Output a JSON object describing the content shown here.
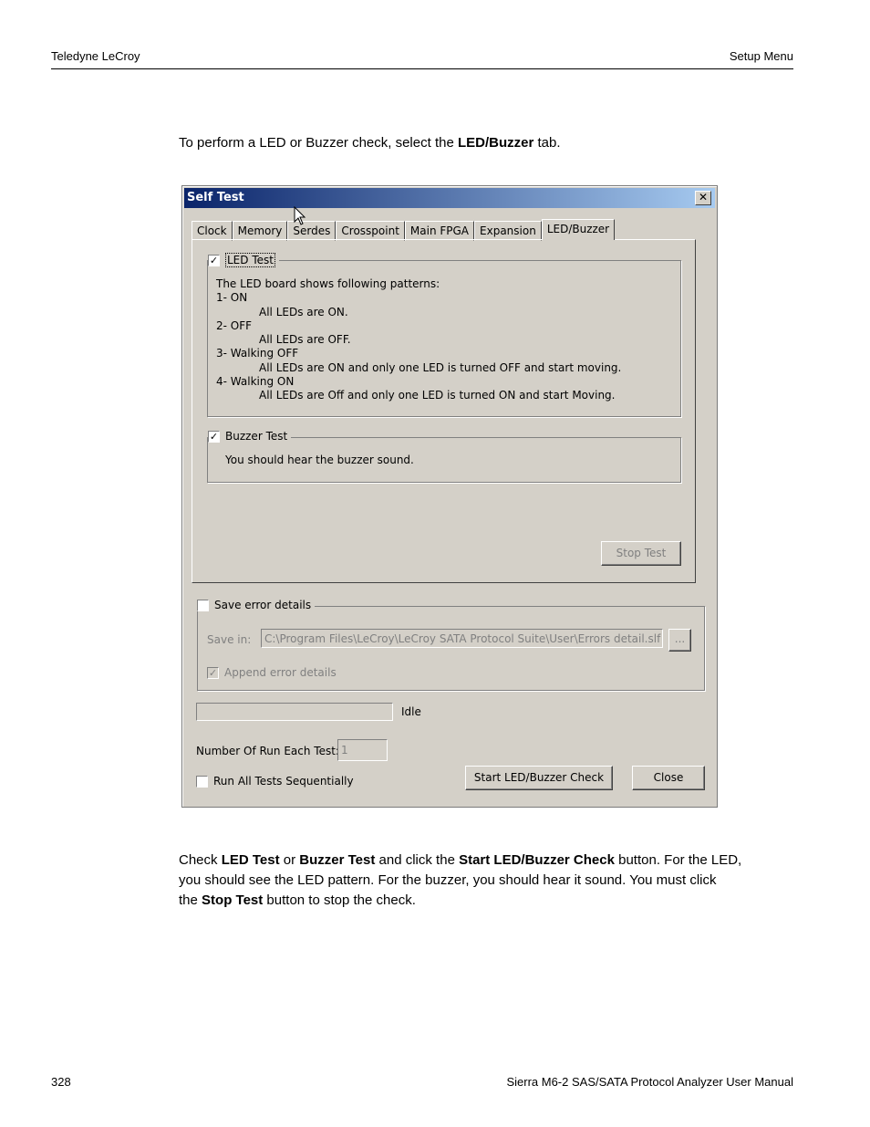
{
  "header": {
    "left": "Teledyne LeCroy",
    "right": "Setup Menu"
  },
  "intro": {
    "before": "To perform a LED or Buzzer check, select the ",
    "bold": "LED/Buzzer",
    "after": " tab."
  },
  "dialog": {
    "title": "Self Test",
    "close_glyph": "✕",
    "tabs": [
      "Clock",
      "Memory",
      "Serdes",
      "Crosspoint",
      "Main FPGA",
      "Expansion",
      "LED/Buzzer"
    ],
    "led_group": {
      "label": "LED Test",
      "checked": true,
      "lines": [
        "The LED board shows following patterns:",
        "1- ON",
        "All LEDs are ON.",
        "2- OFF",
        "All LEDs are OFF.",
        "3- Walking OFF",
        "All LEDs are ON and only one LED is turned OFF and start moving.",
        "4- Walking ON",
        "All LEDs are Off and only one LED is turned ON and start Moving."
      ]
    },
    "buzzer_group": {
      "label": "Buzzer Test",
      "checked": true,
      "text": "You should hear the buzzer sound."
    },
    "stop_button": "Stop Test",
    "save_group": {
      "label": "Save error details",
      "checked": false,
      "save_in_label": "Save in:",
      "path": "C:\\Program Files\\LeCroy\\LeCroy SATA Protocol Suite\\User\\Errors detail.slf",
      "browse_label": "...",
      "append_label": "Append error details",
      "append_checked": true
    },
    "status": "Idle",
    "progress": 0,
    "run_count_label": "Number Of Run Each Test:",
    "run_count_value": "1",
    "run_all_label": "Run All Tests Sequentially",
    "start_button": "Start LED/Buzzer Check",
    "close_button": "Close",
    "check_glyph": "✓"
  },
  "body": {
    "p1_a": "Check ",
    "p1_b": "LED Test",
    "p1_c": " or ",
    "p1_d": "Buzzer Test",
    "p1_e": " and click the ",
    "p1_f": "Start LED/Buzzer Check",
    "p1_g": " button. For the LED,",
    "p2": "you should see the LED pattern. For the buzzer, you should hear it sound. You must click",
    "p3_a": "the ",
    "p3_b": "Stop Test",
    "p3_c": " button to stop the check."
  },
  "footer": {
    "page": "328",
    "title": "Sierra M6-2 SAS/SATA Protocol Analyzer User Manual"
  }
}
